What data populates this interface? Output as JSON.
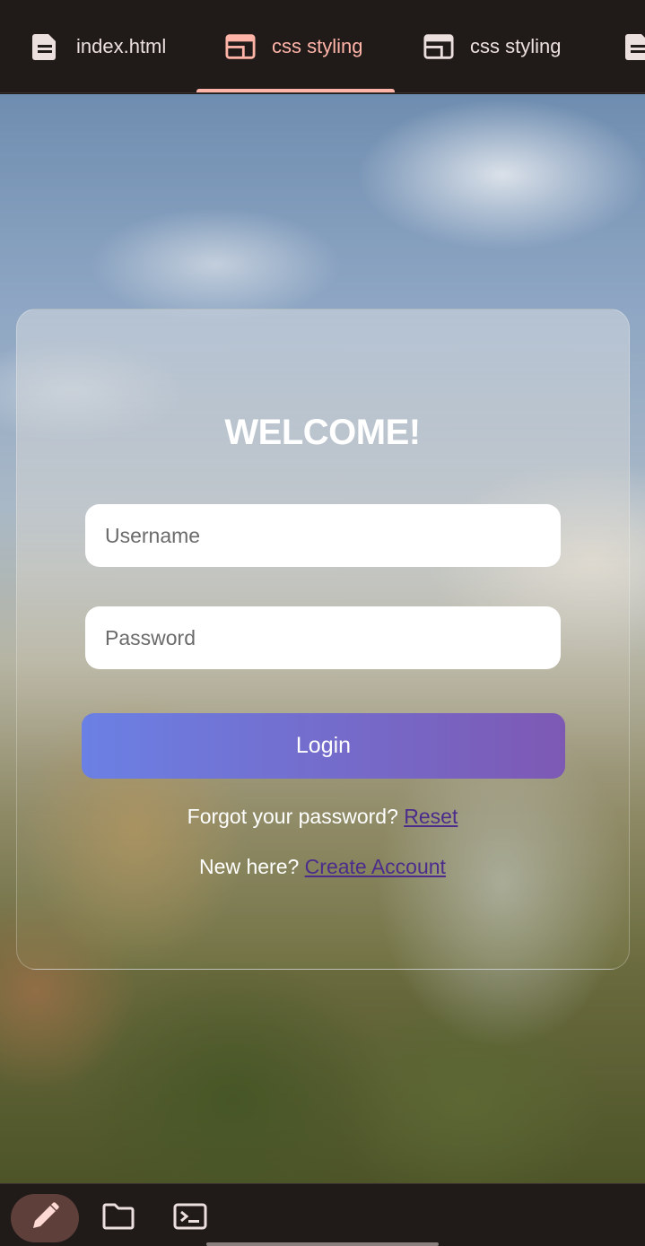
{
  "tabs": [
    {
      "label": "index.html",
      "icon": "document-icon",
      "active": false
    },
    {
      "label": "css styling",
      "icon": "layout-icon",
      "active": true
    },
    {
      "label": "css styling",
      "icon": "layout-icon",
      "active": false
    }
  ],
  "colors": {
    "accent": "#ffb4a8",
    "bar_bg": "#201a19",
    "button_gradient_start": "#6b80e4",
    "button_gradient_end": "#7d59b4",
    "link": "#4b2c8c"
  },
  "login": {
    "title": "WELCOME!",
    "username_placeholder": "Username",
    "password_placeholder": "Password",
    "button_label": "Login",
    "forgot_text": "Forgot your password?",
    "forgot_link": "Reset",
    "new_text": "New here?",
    "create_link": "Create Account"
  },
  "toolbar": {
    "items": [
      {
        "icon": "pencil-icon",
        "active": true
      },
      {
        "icon": "folder-icon",
        "active": false
      },
      {
        "icon": "terminal-icon",
        "active": false
      }
    ]
  }
}
